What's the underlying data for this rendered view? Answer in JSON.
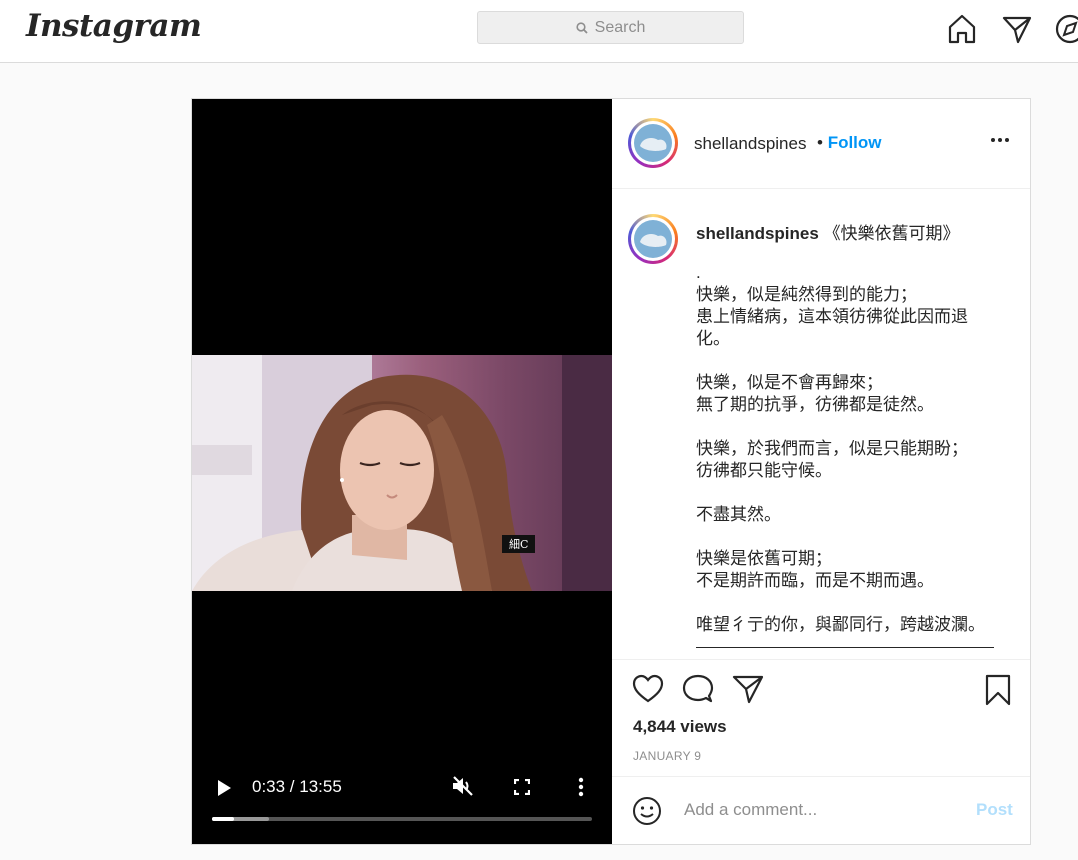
{
  "nav": {
    "logo": "Instagram",
    "search_placeholder": "Search"
  },
  "post": {
    "username": "shellandspines",
    "follow_label": "Follow",
    "separator": "•",
    "caption_title": "《快樂依舊可期》",
    "caption_body": ".\n快樂，似是純然得到的能力；\n患上情緒病，這本領彷彿從此因而退化。\n\n快樂，似是不會再歸來；\n無了期的抗爭，彷彿都是徒然。\n\n快樂，於我們而言，似是只能期盼；\n彷彿都只能守候。\n\n不盡其然。\n\n快樂是依舊可期；\n不是期許而臨，而是不期而遇。\n\n唯望彳亍的你，與鄙同行，跨越波瀾。",
    "views": "4,844 views",
    "date": "JANUARY 9"
  },
  "video": {
    "time": "0:33 / 13:55",
    "subtitle": "細C",
    "progress_played": 0.058,
    "progress_buffered": 0.15
  },
  "comment": {
    "placeholder": "Add a comment...",
    "post_label": "Post"
  },
  "colors": {
    "accent": "#0095f6",
    "post_disabled": "#b2dffc",
    "border": "#dbdbdb"
  },
  "icons": [
    "search-icon",
    "home-icon",
    "direct-icon",
    "explore-icon",
    "more-icon",
    "heart-icon",
    "comment-icon",
    "share-icon",
    "bookmark-icon",
    "emoji-icon",
    "play-icon",
    "mute-icon",
    "fullscreen-icon",
    "video-more-icon"
  ]
}
